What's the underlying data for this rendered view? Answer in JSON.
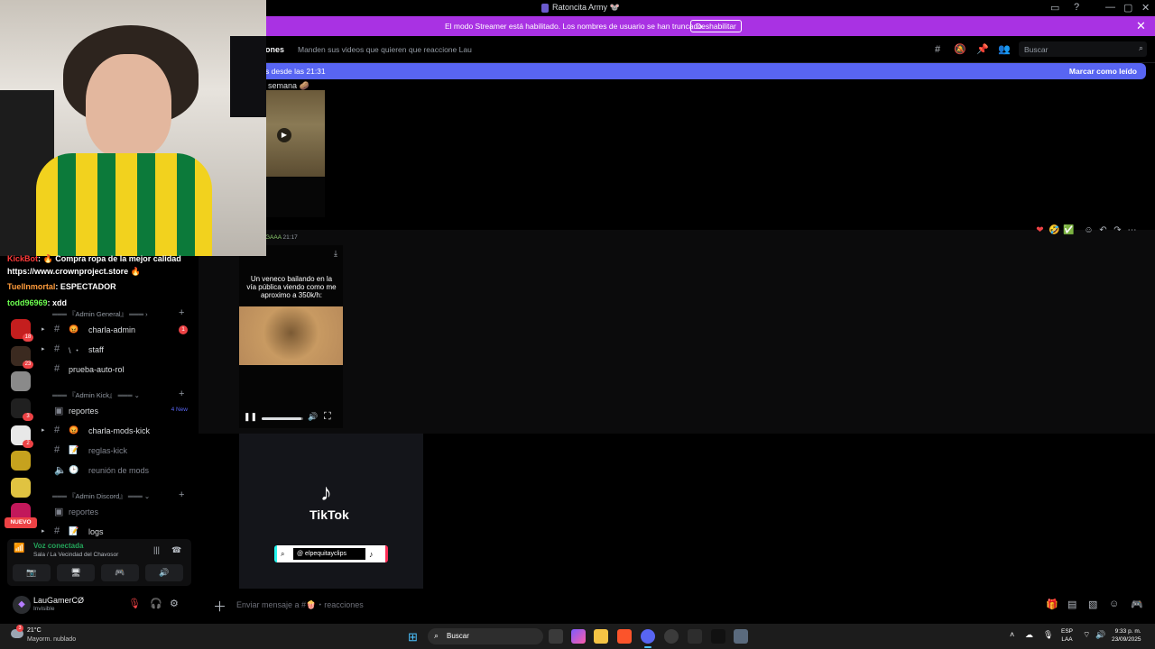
{
  "window": {
    "title": "Ratoncita Army 🐭",
    "minimize_glyph": "—",
    "maximize_glyph": "▢",
    "close_glyph": "✕"
  },
  "streamer_banner": {
    "message": "El modo Streamer está habilitado. Los nombres de usuario se han truncado.",
    "button": "Deshabilitar",
    "close_glyph": "✕",
    "color": "#a932e3"
  },
  "channel_header": {
    "name": "ones",
    "topic": "Manden sus videos que quieren que reaccione Lau",
    "search_placeholder": "Buscar",
    "icons": [
      "threads-icon",
      "mute-icon",
      "pins-icon",
      "members-icon"
    ]
  },
  "new_messages": {
    "since": "s desde las 21:31",
    "mark_read": "Marcar como leído",
    "color": "#5865f2"
  },
  "messages": [
    {
      "text": "semana 🥔"
    },
    {
      "meta_user": "GAAA",
      "meta_time": "21:17",
      "video_caption": "Un veneco bailando en la vía pública viendo como me aproximo a 350k/h:",
      "volume_level": 0.95,
      "reactions": [
        "❤",
        "🤣",
        "✅"
      ]
    }
  ],
  "tiktok_card": {
    "brand": "TikTok",
    "handle": "@ elpequitayclips"
  },
  "composer": {
    "placeholder": "Enviar mensaje a #🍿・reacciones"
  },
  "overlay_chat": [
    {
      "user": "KickBot",
      "text": ": 🔥 Compra ropa de la mejor calidad"
    },
    {
      "user": "",
      "text": "https://www.crownproject.store 🔥"
    },
    {
      "user": "TuelInmortal",
      "text": ": ESPECTADOR"
    },
    {
      "user": "todd96969",
      "text": ": xdd"
    }
  ],
  "servers": [
    {
      "badge": "18",
      "color": "#c41e1e"
    },
    {
      "badge": "23",
      "color": "#3b2a20"
    },
    {
      "badge": "",
      "color": "#8a8a8a"
    },
    {
      "badge": "3",
      "color": "#202020"
    },
    {
      "badge": "2",
      "color": "#e8e8e8"
    },
    {
      "badge": "",
      "color": "#c6a21e"
    },
    {
      "badge": "",
      "color": "#e0c341"
    },
    {
      "badge": "",
      "color": "#c2185b"
    }
  ],
  "new_label": "NUEVO",
  "channels": {
    "cat_admin_general": "═══ 『Admin General』 ═══ ›",
    "cat_admin_kick": "═══ 『Admin Kick』 ═══ ⌄",
    "cat_admin_discord": "═══ 『Admin Discord』 ═══ ⌄",
    "charla_admin": "charla-admin",
    "charla_admin_mentions": "1",
    "staff": "staff",
    "prueba_auto_rol": "prueba-auto-rol",
    "reportes": "reportes",
    "reportes_new": "4 New",
    "charla_mods_kick": "charla-mods-kick",
    "reglas_kick": "reglas-kick",
    "reunion_de_mods": "reunión de mods",
    "reportes_discord": "reportes",
    "logs": "logs"
  },
  "voice": {
    "status": "Voz conectada",
    "room": "Sala / La Vecindad del Chavosor"
  },
  "user": {
    "name": "LauGamerCØ",
    "status": "Invisible"
  },
  "taskbar": {
    "temp": "21°C",
    "weather": "Mayorm. nublado",
    "weather_badge": "3",
    "search": "Buscar",
    "lang_line1": "ESP",
    "lang_line2": "LAA",
    "time": "9:33 p. m.",
    "date": "23/09/2025"
  }
}
